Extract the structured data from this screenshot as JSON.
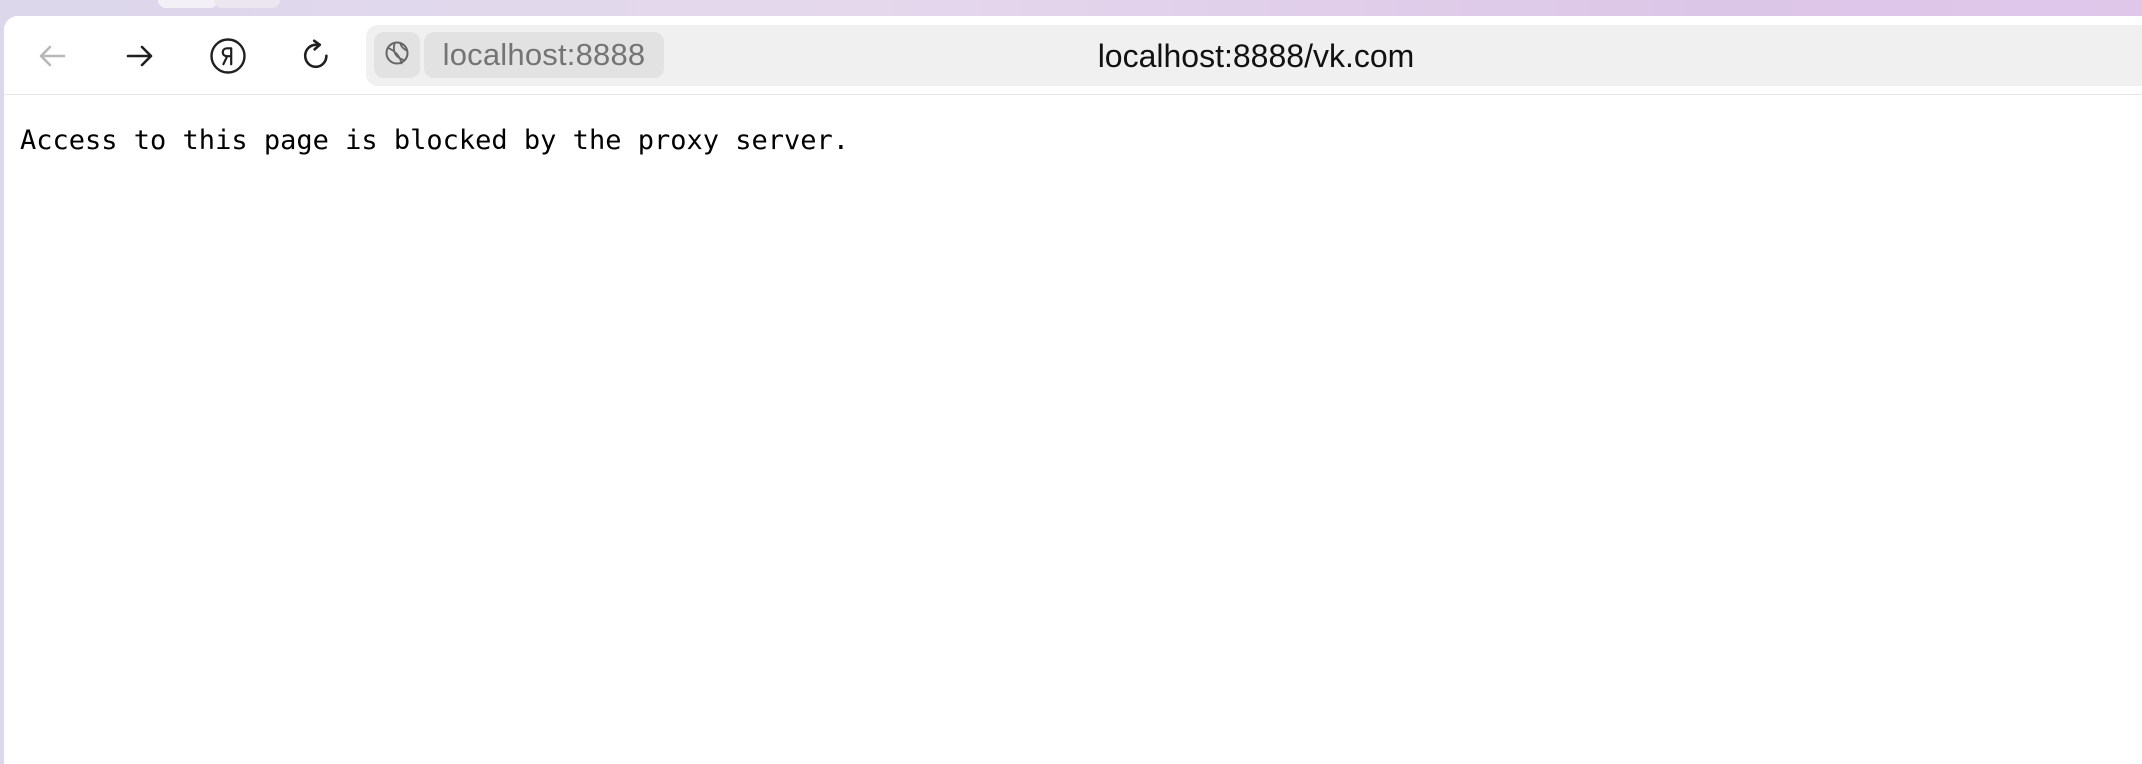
{
  "browser": {
    "tabs": [
      {
        "label": ""
      },
      {
        "label": ""
      }
    ],
    "toolbar": {
      "buttons": [
        {
          "name": "back",
          "icon": "arrow-left-icon",
          "enabled": false
        },
        {
          "name": "forward",
          "icon": "arrow-right-icon",
          "enabled": true
        },
        {
          "name": "yandex",
          "icon": "yandex-logo-icon",
          "enabled": true
        },
        {
          "name": "reload",
          "icon": "reload-icon",
          "enabled": true
        }
      ],
      "site_chip": {
        "icon": "globe-icon",
        "label": "localhost:8888"
      },
      "address": "localhost:8888/vk.com"
    }
  },
  "page": {
    "message": "Access to this page is blocked by the proxy server."
  },
  "colors": {
    "frame_start": "#dcd7eb",
    "frame_end": "#dfc7ea",
    "omnibox_bg": "#f0f0f0",
    "chip_bg": "#e2e2e2",
    "disabled_icon": "#b8b8b8",
    "text": "#111111"
  }
}
